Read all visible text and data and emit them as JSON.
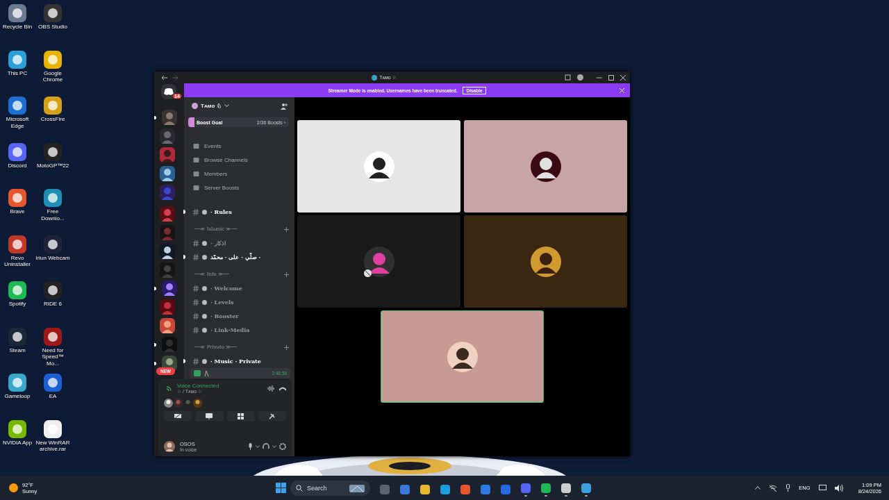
{
  "desktop_icons": [
    {
      "label": "Recycle Bin"
    },
    {
      "label": "This PC"
    },
    {
      "label": "Microsoft Edge"
    },
    {
      "label": "Discord"
    },
    {
      "label": "Brave"
    },
    {
      "label": "Revo Uninstaller"
    },
    {
      "label": "Spotify"
    },
    {
      "label": "Steam"
    },
    {
      "label": "Gameloop"
    },
    {
      "label": "NVIDIA App"
    },
    {
      "label": "OBS Studio"
    },
    {
      "label": "Google Chrome"
    },
    {
      "label": "CrossFire"
    },
    {
      "label": "MotoGP™22"
    },
    {
      "label": "Free Downlo..."
    },
    {
      "label": "Iriun Webcam"
    },
    {
      "label": "RIDE 6"
    },
    {
      "label": "Need for Speed™ Mo..."
    },
    {
      "label": "EA"
    },
    {
      "label": "New WinRAR archive.rar"
    }
  ],
  "window": {
    "title": "Tᴀᴍᴏ ♘"
  },
  "banner": {
    "text": "Streamer Mode is enabled. Usernames have been truncated.",
    "button": "Disable"
  },
  "server_list": {
    "home_badge": "14",
    "new_badge": "NEW",
    "servers": [
      {
        "unread": true
      },
      {
        "unread": false
      },
      {
        "unread": false
      },
      {
        "unread": false
      },
      {
        "unread": false
      },
      {
        "unread": false
      },
      {
        "unread": false
      },
      {
        "unread": false
      },
      {
        "unread": false
      },
      {
        "unread": true
      },
      {
        "unread": false
      },
      {
        "unread": false
      },
      {
        "unread": true
      },
      {
        "unread": true
      }
    ]
  },
  "sidebar": {
    "server_name": "Tᴀᴍᴏ ♘",
    "boost_goal": {
      "label": "Boost Goal",
      "progress": "2/36 Boosts ›",
      "level": 0.06
    },
    "items": [
      {
        "kind": "nav",
        "label": "Events"
      },
      {
        "kind": "nav",
        "label": "Browse Channels"
      },
      {
        "kind": "nav",
        "label": "Members"
      },
      {
        "kind": "nav",
        "label": "Server Boosts"
      },
      {
        "kind": "channel",
        "label": "· Rules",
        "unread": true
      },
      {
        "kind": "category",
        "label": "──≪ Islamic ≫──"
      },
      {
        "kind": "channel",
        "label": "· اذكار",
        "unread": false
      },
      {
        "kind": "channel",
        "label": "صلّي · على · محمّد ·",
        "unread": true
      },
      {
        "kind": "category",
        "label": "──≪ Info ≫──"
      },
      {
        "kind": "channel",
        "label": "· Welcome",
        "unread": false
      },
      {
        "kind": "channel",
        "label": "· Levels",
        "unread": false
      },
      {
        "kind": "channel",
        "label": "· Booster",
        "unread": false
      },
      {
        "kind": "channel",
        "label": "· Link-Media",
        "unread": false
      },
      {
        "kind": "category",
        "label": "──≪ Private ≫──"
      },
      {
        "kind": "channel",
        "label": "· Music · Private",
        "unread": true
      }
    ],
    "voice_user": {
      "timer": "3:48:56"
    }
  },
  "voice_panel": {
    "status": "Voice Connected",
    "channel": "♘ / Tᴀᴍᴏ ♘"
  },
  "user": {
    "name": "OSOS",
    "status": "In voice"
  },
  "tiles": [
    {
      "color": "#e6e6e6",
      "speaking": false
    },
    {
      "color": "#c8a4a7",
      "speaking": false
    },
    {
      "color": "#1a1a1a",
      "speaking": false
    },
    {
      "color": "#3a2712",
      "speaking": false
    },
    {
      "color": "#c79a93",
      "speaking": true
    }
  ],
  "taskbar": {
    "temperature": "92°F",
    "weather": "Sunny",
    "search": {
      "placeholder": "Search"
    },
    "apps": [
      {
        "running": false
      },
      {
        "running": false
      },
      {
        "running": false
      },
      {
        "running": false
      },
      {
        "running": false
      },
      {
        "running": false
      },
      {
        "running": false
      },
      {
        "running": true
      },
      {
        "running": true
      },
      {
        "running": true
      },
      {
        "running": true
      }
    ],
    "language": "ENG",
    "time": "1:09 PM",
    "date": "8/24/2026"
  }
}
